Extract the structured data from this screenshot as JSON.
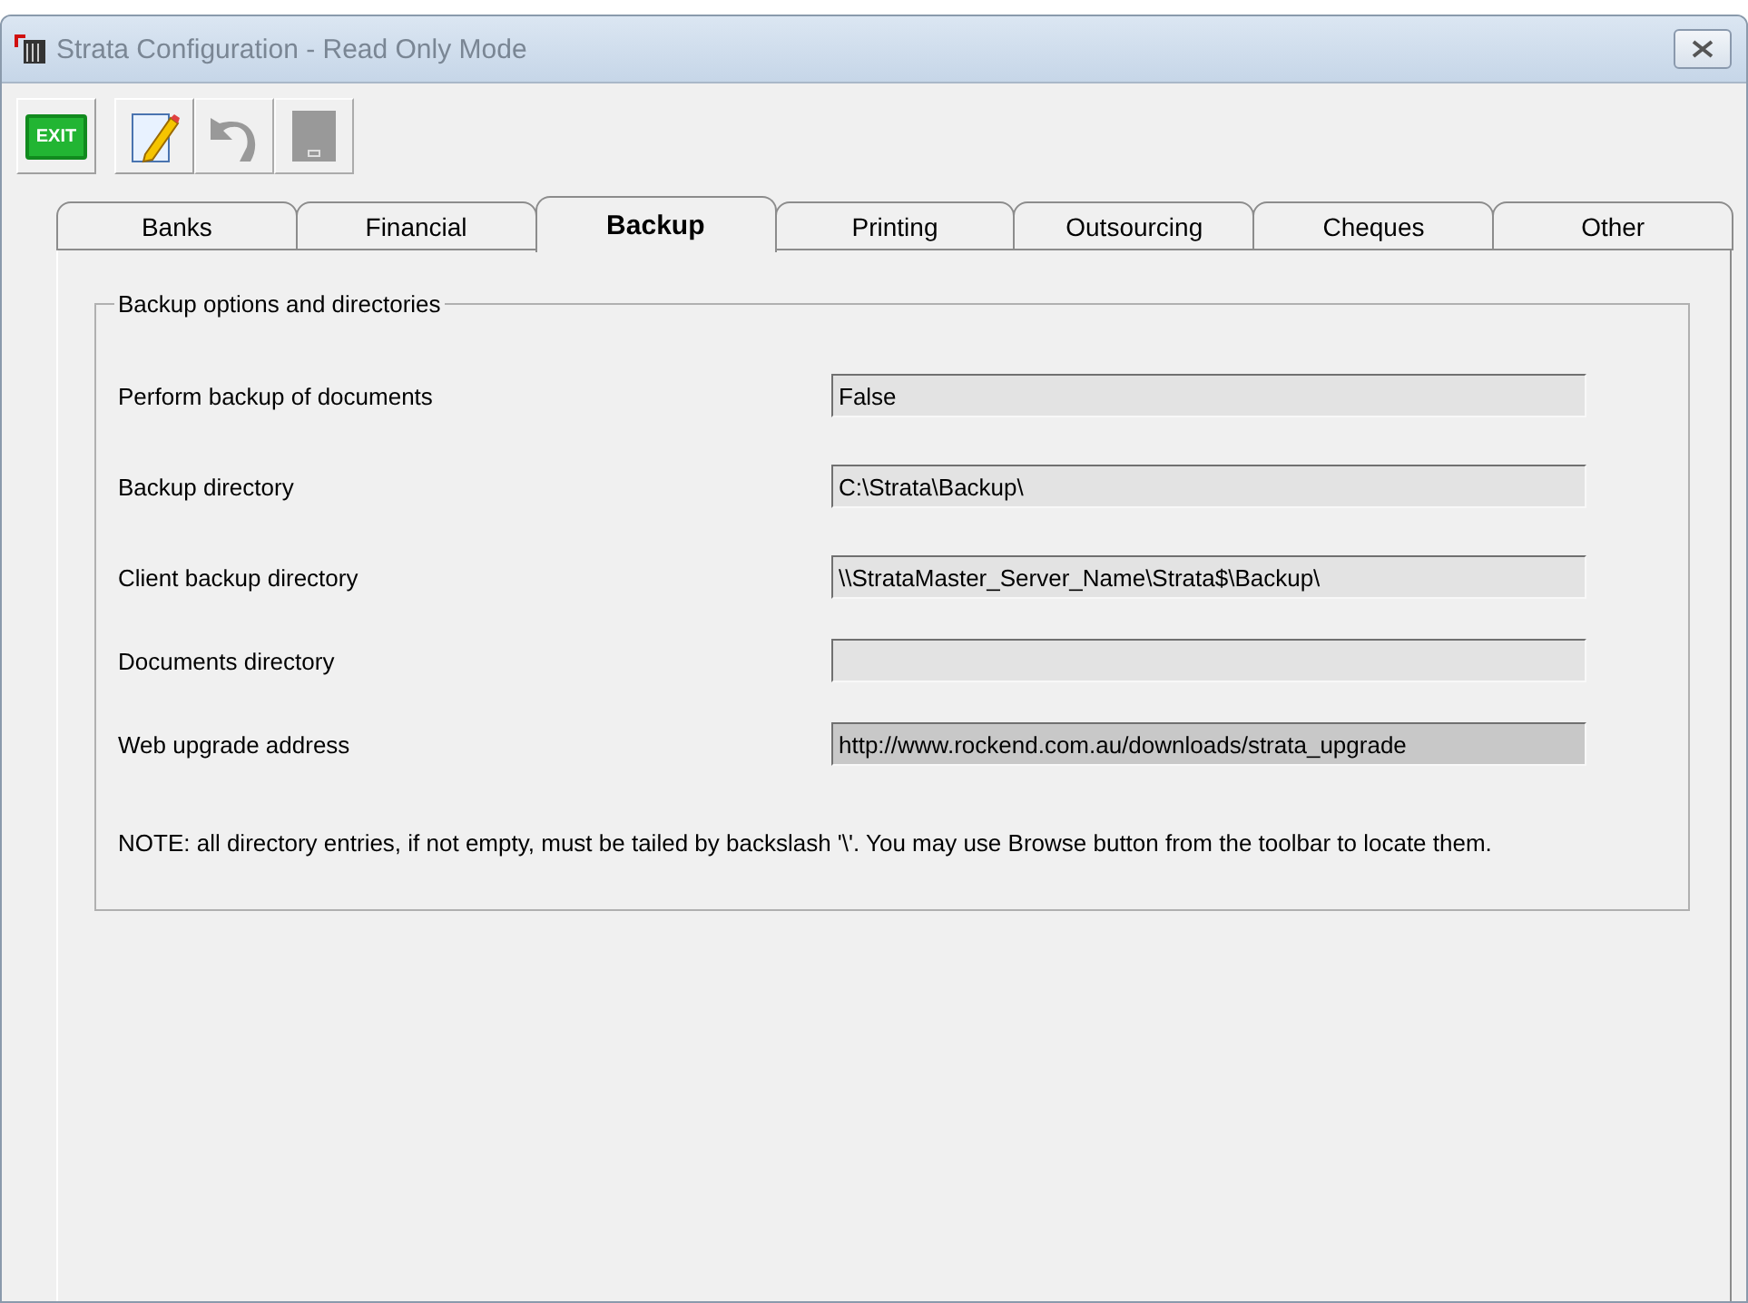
{
  "window": {
    "title": "Strata Configuration - Read Only Mode"
  },
  "toolbar": [
    {
      "kind": "exit",
      "label": "EXIT",
      "disabled": false
    },
    {
      "kind": "edit",
      "disabled": false
    },
    {
      "kind": "undo",
      "disabled": true
    },
    {
      "kind": "save",
      "disabled": true
    }
  ],
  "tabs": [
    {
      "label": "Banks",
      "selected": false
    },
    {
      "label": "Financial",
      "selected": false
    },
    {
      "label": "Backup",
      "selected": true
    },
    {
      "label": "Printing",
      "selected": false
    },
    {
      "label": "Outsourcing",
      "selected": false
    },
    {
      "label": "Cheques",
      "selected": false
    },
    {
      "label": "Other",
      "selected": false
    }
  ],
  "group": {
    "title": "Backup options and directories",
    "fields": [
      {
        "label": "Perform backup of documents",
        "value": "False",
        "selected": false
      },
      {
        "label": "Backup directory",
        "value": "C:\\Strata\\Backup\\",
        "selected": false
      },
      {
        "label": "Client backup directory",
        "value": "\\\\StrataMaster_Server_Name\\Strata$\\Backup\\",
        "selected": false
      },
      {
        "label": "Documents directory",
        "selected": false
      },
      {
        "label": "Web upgrade address",
        "value": "http://www.rockend.com.au/downloads/strata_upgrade",
        "selected": true
      }
    ],
    "note": "NOTE: all directory entries, if not empty, must be tailed by backslash '\\'. You may use Browse button from the toolbar to locate them."
  }
}
